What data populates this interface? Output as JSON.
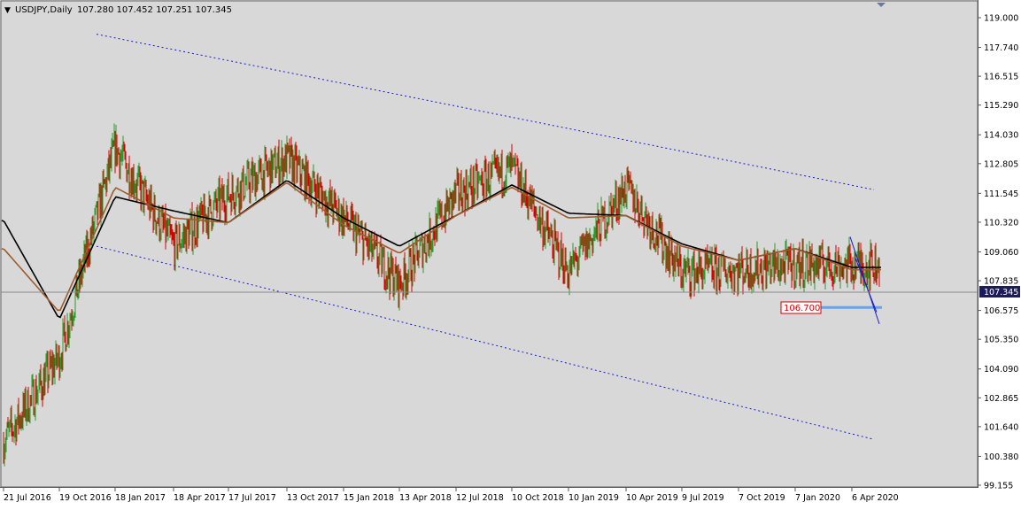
{
  "header": {
    "menu_glyph": "▼",
    "symbol": "USDJPY,Daily",
    "ohlc": "107.280 107.452 107.251 107.345"
  },
  "colors": {
    "background": "#d8d8d8",
    "bull": "#2a9a2a",
    "bear": "#d80000",
    "ma_fast": "#a05a2c",
    "ma_slow": "#000000",
    "channel": "#1a1acc",
    "level": "#6fa0e8",
    "price_label_bg": "#1c1c5c"
  },
  "price_axis": {
    "ticks": [
      "119.000",
      "117.740",
      "116.515",
      "115.290",
      "114.030",
      "112.805",
      "111.545",
      "110.320",
      "109.060",
      "107.835",
      "106.575",
      "105.350",
      "104.090",
      "102.865",
      "101.640",
      "100.380",
      "99.155"
    ],
    "current_price": "107.345"
  },
  "time_axis": {
    "labels": [
      "21 Jul 2016",
      "19 Oct 2016",
      "18 Jan 2017",
      "18 Apr 2017",
      "17 Jul 2017",
      "13 Oct 2017",
      "15 Jan 2018",
      "13 Apr 2018",
      "12 Jul 2018",
      "10 Oct 2018",
      "10 Jan 2019",
      "10 Apr 2019",
      "9 Jul 2019",
      "7 Oct 2019",
      "7 Jan 2020",
      "6 Apr 2020"
    ]
  },
  "annotations": {
    "level_label": "106.700"
  },
  "chart_data": {
    "type": "line",
    "title": "USDJPY,Daily",
    "xlabel": "",
    "ylabel": "",
    "ylim": [
      99.155,
      119.3
    ],
    "x": [
      "21 Jul 2016",
      "19 Oct 2016",
      "18 Jan 2017",
      "18 Apr 2017",
      "17 Jul 2017",
      "13 Oct 2017",
      "15 Jan 2018",
      "13 Apr 2018",
      "12 Jul 2018",
      "10 Oct 2018",
      "10 Jan 2019",
      "10 Apr 2019",
      "9 Jul 2019",
      "7 Oct 2019",
      "7 Jan 2020",
      "6 Apr 2020"
    ],
    "series": [
      {
        "values": [
          101.0,
          104.6,
          113.5,
          109.3,
          111.5,
          113.0,
          110.5,
          107.7,
          111.5,
          112.6,
          108.2,
          111.8,
          108.2,
          108.3,
          108.5,
          108.5
        ]
      },
      {
        "values": [
          109.2,
          106.5,
          111.8,
          110.5,
          110.3,
          112.0,
          110.2,
          109.0,
          110.6,
          111.8,
          110.5,
          110.6,
          109.3,
          108.7,
          109.2,
          108.3
        ]
      },
      {
        "values": [
          110.4,
          106.2,
          111.4,
          110.8,
          110.3,
          112.1,
          110.5,
          109.3,
          110.6,
          111.9,
          110.7,
          110.6,
          109.4,
          108.7,
          109.2,
          108.4
        ]
      }
    ],
    "channel_upper": {
      "from": {
        "date": "19 Oct 2016",
        "price": 118.3
      },
      "to": {
        "date": "6 Apr 2020",
        "price": 111.7
      }
    },
    "channel_lower": {
      "from": {
        "date": "19 Oct 2016",
        "price": 109.3
      },
      "to": {
        "date": "6 Apr 2020",
        "price": 101.1
      }
    },
    "horizontal_level": 106.7,
    "current_price": 107.345
  }
}
